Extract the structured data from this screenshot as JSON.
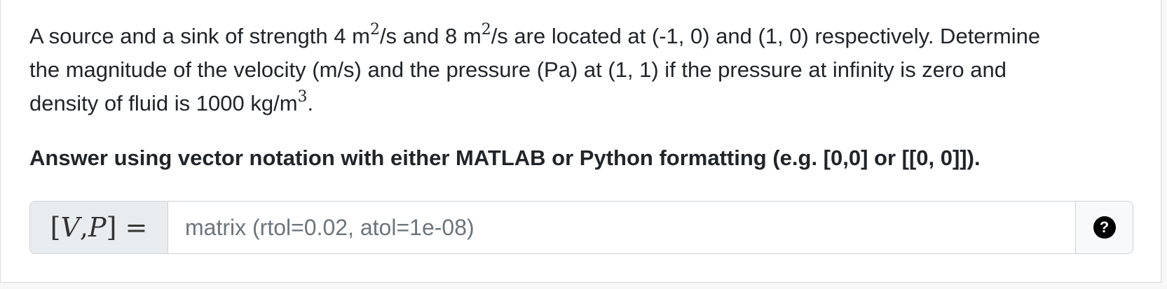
{
  "question": {
    "line1_pre": "A source and a sink of strength 4 m",
    "line1_sup1": "2",
    "line1_mid": "/s and 8 m",
    "line1_sup2": "2",
    "line1_post": "/s are located at (-1, 0) and (1, 0) respectively. Determine",
    "line2": "the magnitude of the velocity (m/s) and the pressure (Pa) at (1, 1) if the pressure at infinity is zero and",
    "line3_pre": "density of fluid is 1000 kg/m",
    "line3_sup": "3",
    "line3_post": "."
  },
  "instruction": "Answer using vector notation with either MATLAB or Python formatting (e.g. [0,0] or [[0, 0]]).",
  "answer_input": {
    "prefix_open": "[",
    "prefix_v": "V",
    "prefix_comma": ", ",
    "prefix_p": "P",
    "prefix_close": "] =",
    "value": "",
    "placeholder": "matrix (rtol=0.02, atol=1e-08)"
  },
  "help": {
    "icon": "question-circle-icon",
    "glyph": "?"
  }
}
